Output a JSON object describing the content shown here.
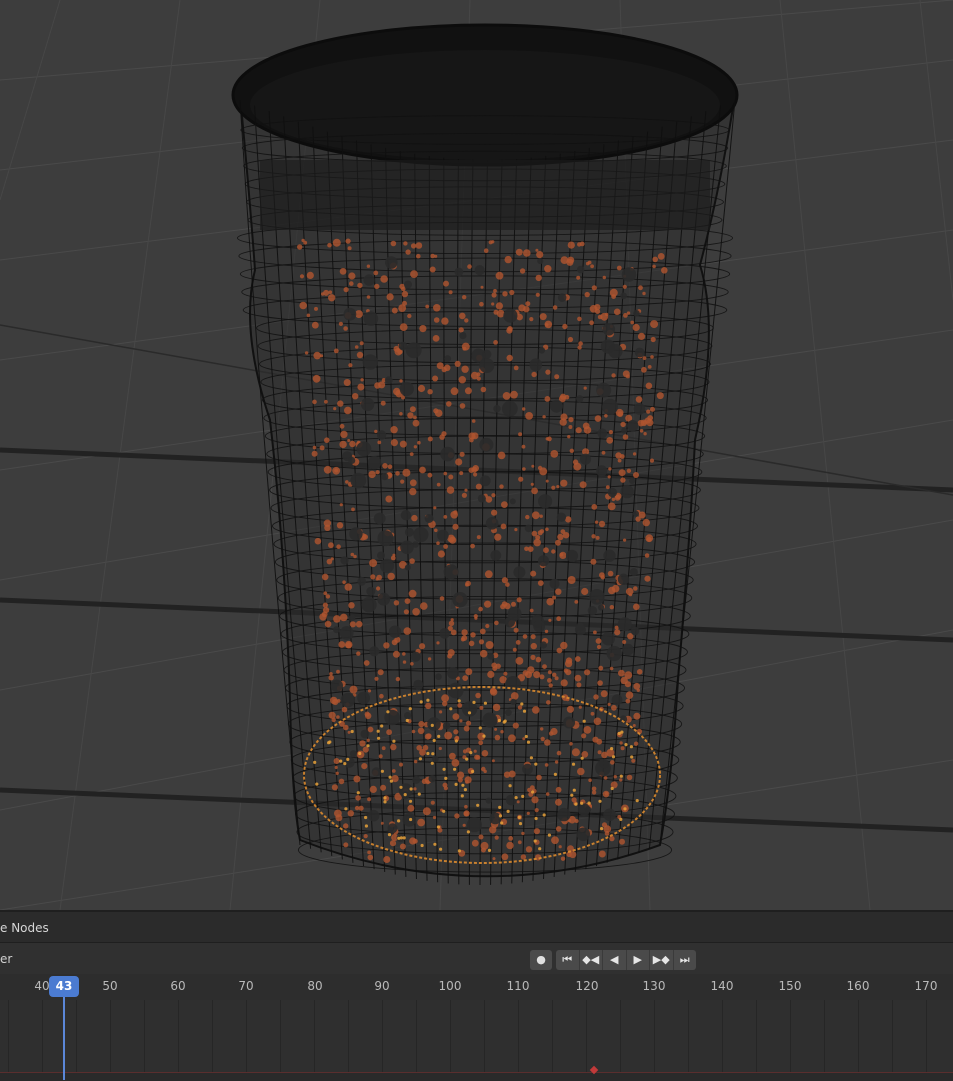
{
  "node_editor": {
    "title": "e Nodes"
  },
  "timeline": {
    "menu_label": "er",
    "current_frame": "43",
    "ruler_labels": [
      "40",
      "50",
      "60",
      "70",
      "80",
      "90",
      "100",
      "110",
      "120",
      "130",
      "140",
      "150",
      "160",
      "170"
    ],
    "buttons": {
      "record": "●",
      "jump_start": "⏮",
      "prev_keyframe": "◆◀",
      "play_reverse": "◀",
      "play": "▶",
      "next_keyframe": "▶◆",
      "jump_end": "⏭"
    }
  },
  "viewport": {
    "object": "glass-with-particles",
    "colors": {
      "bg": "#3d3d3d",
      "wire": "#0a0a0a",
      "particle": "#b0552f"
    }
  }
}
